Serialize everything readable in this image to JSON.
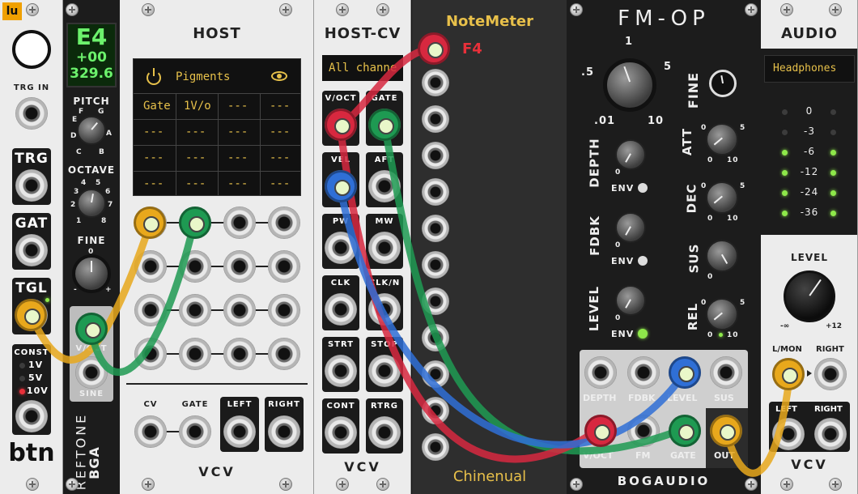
{
  "colors": {
    "cable_yellow": "#e8a81c",
    "cable_green": "#1e9a52",
    "cable_red": "#d7283f",
    "cable_blue": "#2f6fd6",
    "display_text": "#e6c04a",
    "tuner_green": "#6cf26c"
  },
  "btn": {
    "logo": "lu",
    "trg_in": "TRG IN",
    "trg": "TRG",
    "gat": "GAT",
    "tgl": "TGL",
    "const": "CONST",
    "volts": [
      "1V",
      "5V",
      "10V"
    ],
    "brand": "btn"
  },
  "reftone": {
    "note": "E4",
    "cents": "+00",
    "freq": "329.6",
    "pitch": "PITCH",
    "pitch_letters": [
      "F",
      "G",
      "E",
      "A",
      "D",
      "B",
      "C"
    ],
    "octave": "OCTAVE",
    "octave_nums": [
      "4",
      "5",
      "3",
      "6",
      "2",
      "7",
      "1",
      "8"
    ],
    "fine": "FINE",
    "fine_marks": [
      "0",
      "-",
      "+"
    ],
    "voct": "V/OCT",
    "sine": "SINE",
    "name": "REFTONE",
    "brand": "BGA"
  },
  "host": {
    "title": "HOST",
    "plugin": "Pigments",
    "row1": [
      "Gate",
      "1V/o",
      "---",
      "---"
    ],
    "empty": "---",
    "cv": "CV",
    "gate": "GATE",
    "left": "LEFT",
    "right": "RIGHT",
    "brand": "VCV"
  },
  "hostcv": {
    "title": "HOST-CV",
    "channel": "All channe",
    "ports": [
      "V/OCT",
      "GATE",
      "VEL",
      "AFT",
      "PW",
      "MW",
      "CLK",
      "CLK/N",
      "STRT",
      "STOP",
      "CONT",
      "RTRG"
    ],
    "brand": "VCV"
  },
  "notemeter": {
    "title": "NoteMeter",
    "note": "F4",
    "brand": "Chinenual"
  },
  "fmop": {
    "title": "FM-OP",
    "ratio_marks": [
      ".5",
      "1",
      "5",
      ".01",
      "10"
    ],
    "fine": "FINE",
    "depth": "DEPTH",
    "fdbk": "FDBK",
    "level": "LEVEL",
    "env": "ENV",
    "att": "ATT",
    "dec": "DEC",
    "sus": "SUS",
    "rel": "REL",
    "scale_lo": "0",
    "scale_hi": "10",
    "scale_mid": "5",
    "ports_top": [
      "DEPTH",
      "FDBK",
      "LEVEL",
      "SUS"
    ],
    "ports_bot": [
      "V/OCT",
      "FM",
      "GATE",
      "OUT"
    ],
    "brand": "BOGAUDIO"
  },
  "audio": {
    "title": "AUDIO",
    "device": "Headphones",
    "meter": [
      "0",
      "-3",
      "-6",
      "-12",
      "-24",
      "-36"
    ],
    "level": "LEVEL",
    "level_lo": "-∞",
    "level_hi": "+12",
    "lmon": "L/MON",
    "right": "RIGHT",
    "left": "LEFT",
    "right2": "RIGHT",
    "brand": "VCV"
  }
}
